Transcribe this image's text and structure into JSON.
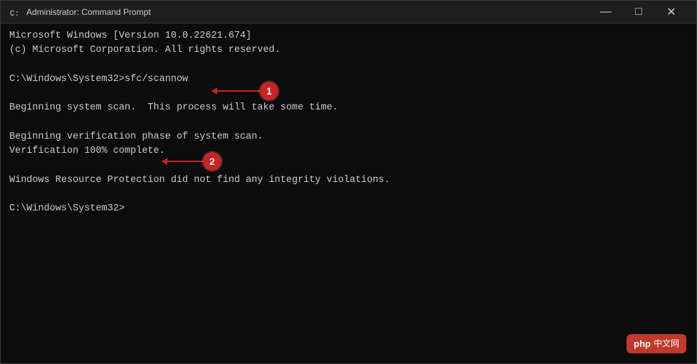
{
  "window": {
    "title": "Administrator: Command Prompt",
    "icon": "cmd-icon"
  },
  "titlebar": {
    "minimize_label": "—",
    "maximize_label": "□",
    "close_label": "✕"
  },
  "console": {
    "lines": [
      "Microsoft Windows [Version 10.0.22621.674]",
      "(c) Microsoft Corporation. All rights reserved.",
      "",
      "C:\\Windows\\System32>sfc/scannow",
      "",
      "Beginning system scan.  This process will take some time.",
      "",
      "Beginning verification phase of system scan.",
      "Verification 100% complete.",
      "",
      "Windows Resource Protection did not find any integrity violations.",
      "",
      "C:\\Windows\\System32>"
    ]
  },
  "annotations": [
    {
      "id": "1",
      "label": "1"
    },
    {
      "id": "2",
      "label": "2"
    }
  ],
  "watermark": {
    "brand": "php",
    "site": "中文网"
  }
}
